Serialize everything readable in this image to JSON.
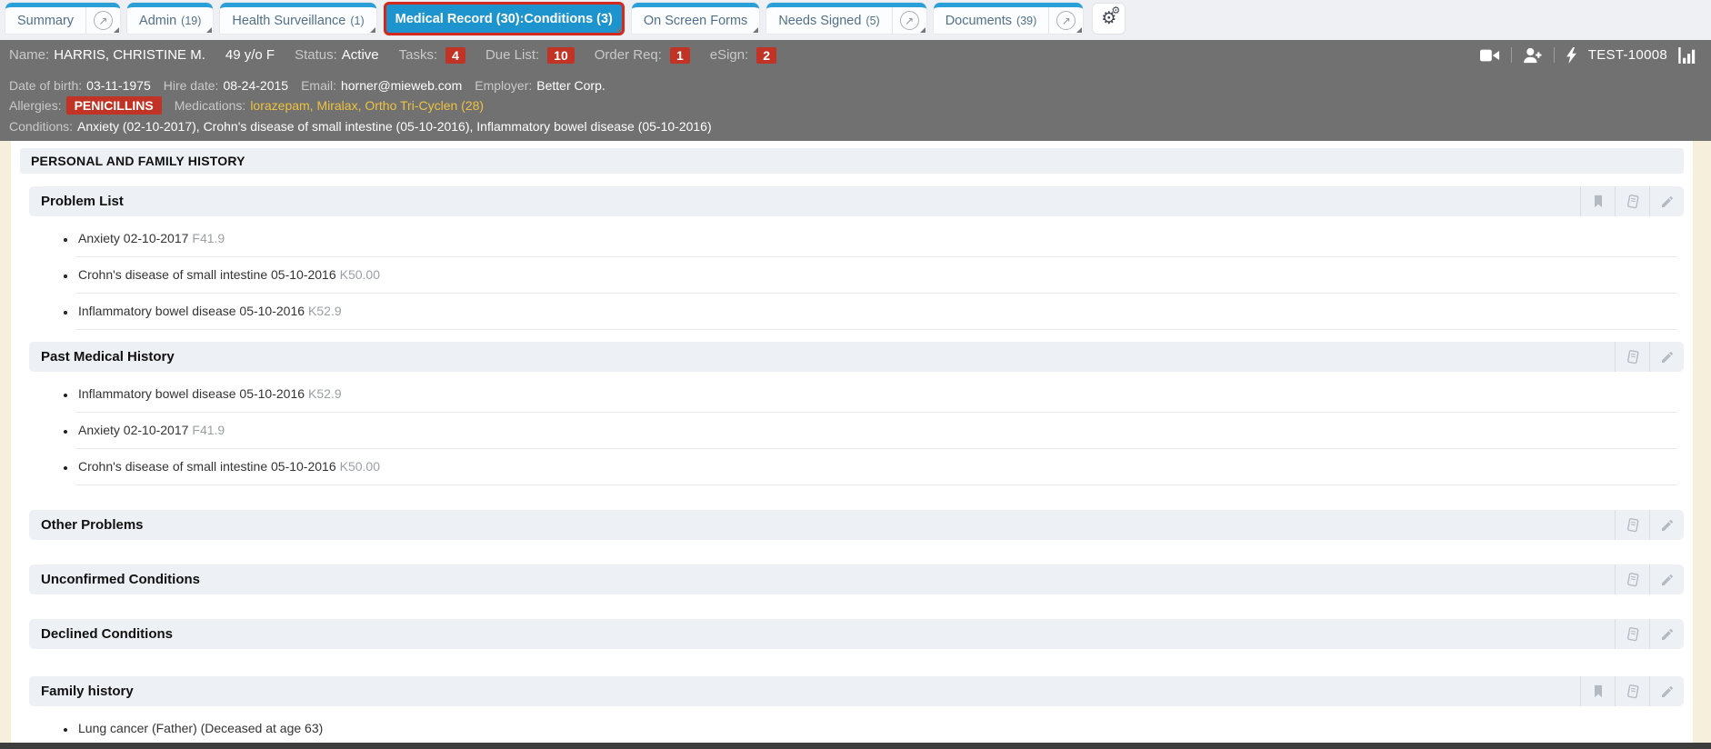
{
  "colors": {
    "accent_blue": "#1d94ce",
    "alert_red": "#c13425",
    "selected_tab_border_red": "#d3291c",
    "medication_yellow": "#edc240",
    "header_gray": "#717171",
    "page_cream": "#f5efdc",
    "section_bar_gray": "#edf0f4"
  },
  "tab_bar": {
    "tabs": [
      {
        "label": "Summary"
      },
      {
        "label": "Admin",
        "count": "(19)"
      },
      {
        "label": "Health Surveillance",
        "count": "(1)"
      },
      {
        "label": "Medical Record (30):Conditions (3)",
        "selected": true
      },
      {
        "label": "On Screen Forms"
      },
      {
        "label": "Needs Signed",
        "count": "(5)"
      },
      {
        "label": "Documents",
        "count": "(39)"
      }
    ]
  },
  "patient_bar": {
    "row1": {
      "name_label": "Name:",
      "name": "HARRIS, CHRISTINE M.",
      "age_sex": "49 y/o F",
      "status_label": "Status:",
      "status": "Active",
      "tasks_label": "Tasks:",
      "tasks": "4",
      "due_list_label": "Due List:",
      "due_list": "10",
      "order_req_label": "Order Req:",
      "order_req": "1",
      "esign_label": "eSign:",
      "esign": "2",
      "patient_id": "TEST-10008"
    },
    "row2": {
      "dob_label": "Date of birth:",
      "dob": "03-11-1975",
      "hire_label": "Hire date:",
      "hire": "08-24-2015",
      "email_label": "Email:",
      "email": "horner@mieweb.com",
      "employer_label": "Employer:",
      "employer": "Better Corp."
    },
    "row3": {
      "allergies_label": "Allergies:",
      "allergy": "PENICILLINS",
      "medications_label": "Medications:",
      "medications": "lorazepam, Miralax, Ortho Tri-Cyclen (28)"
    },
    "row4": {
      "conditions_label": "Conditions:",
      "conditions": "Anxiety (02-10-2017), Crohn's disease of small intestine (05-10-2016), Inflammatory bowel disease (05-10-2016)"
    }
  },
  "main": {
    "page_title": "PERSONAL AND FAMILY HISTORY",
    "sections": [
      {
        "title": "Problem List",
        "icons": [
          "bookmark",
          "book",
          "pencil"
        ],
        "items": [
          {
            "text": "Anxiety 02-10-2017",
            "code": "F41.9"
          },
          {
            "text": "Crohn's disease of small intestine 05-10-2016",
            "code": "K50.00"
          },
          {
            "text": "Inflammatory bowel disease 05-10-2016",
            "code": "K52.9"
          }
        ]
      },
      {
        "title": "Past Medical History",
        "icons": [
          "book",
          "pencil"
        ],
        "items": [
          {
            "text": "Inflammatory bowel disease 05-10-2016",
            "code": "K52.9"
          },
          {
            "text": "Anxiety 02-10-2017",
            "code": "F41.9"
          },
          {
            "text": "Crohn's disease of small intestine 05-10-2016",
            "code": "K50.00"
          }
        ]
      },
      {
        "title": "Other Problems",
        "icons": [
          "book",
          "pencil"
        ],
        "items": []
      },
      {
        "title": "Unconfirmed Conditions",
        "icons": [
          "book",
          "pencil"
        ],
        "items": []
      },
      {
        "title": "Declined Conditions",
        "icons": [
          "book",
          "pencil"
        ],
        "items": []
      },
      {
        "title": "Family history",
        "icons": [
          "bookmark",
          "book",
          "pencil"
        ],
        "items": [
          {
            "text": "Lung cancer (Father) (Deceased at age 63)",
            "code": ""
          }
        ]
      }
    ]
  }
}
